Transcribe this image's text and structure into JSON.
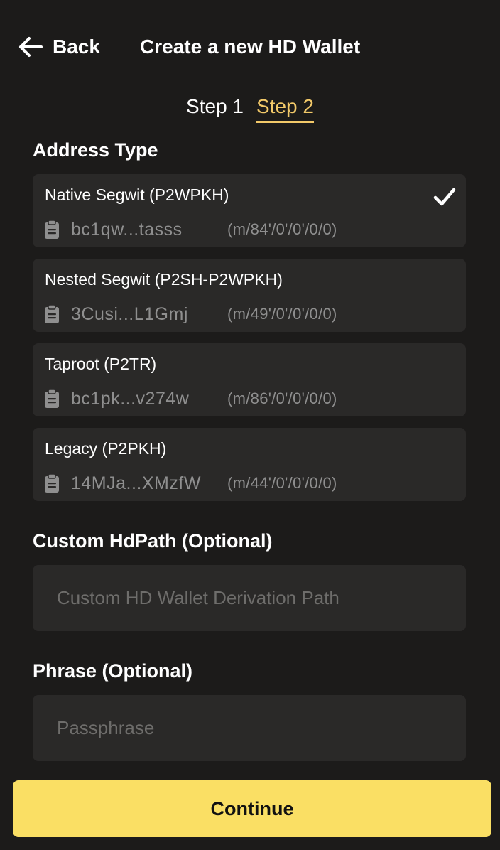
{
  "header": {
    "back_label": "Back",
    "title": "Create a new HD Wallet"
  },
  "steps": [
    {
      "label": "Step 1",
      "active": false
    },
    {
      "label": "Step 2",
      "active": true
    }
  ],
  "address_type": {
    "title": "Address Type",
    "selected_index": 0,
    "options": [
      {
        "name": "Native Segwit (P2WPKH)",
        "address": "bc1qw...tasss",
        "path": "(m/84'/0'/0'/0/0)"
      },
      {
        "name": "Nested Segwit (P2SH-P2WPKH)",
        "address": "3Cusi...L1Gmj",
        "path": "(m/49'/0'/0'/0/0)"
      },
      {
        "name": "Taproot (P2TR)",
        "address": "bc1pk...v274w",
        "path": "(m/86'/0'/0'/0/0)"
      },
      {
        "name": "Legacy (P2PKH)",
        "address": "14MJa...XMzfW",
        "path": "(m/44'/0'/0'/0/0)"
      }
    ]
  },
  "custom_hdpath": {
    "title": "Custom HdPath (Optional)",
    "placeholder": "Custom HD Wallet Derivation Path",
    "value": ""
  },
  "phrase": {
    "title": "Phrase (Optional)",
    "placeholder": "Passphrase",
    "value": ""
  },
  "continue_label": "Continue",
  "colors": {
    "background": "#1c1b1a",
    "card": "#2a2928",
    "accent": "#f2c969",
    "button": "#fadf64",
    "muted_text": "#8f8f8f"
  },
  "icons": {
    "back": "arrow-left-icon",
    "copy": "clipboard-icon",
    "selected": "checkmark-icon"
  }
}
